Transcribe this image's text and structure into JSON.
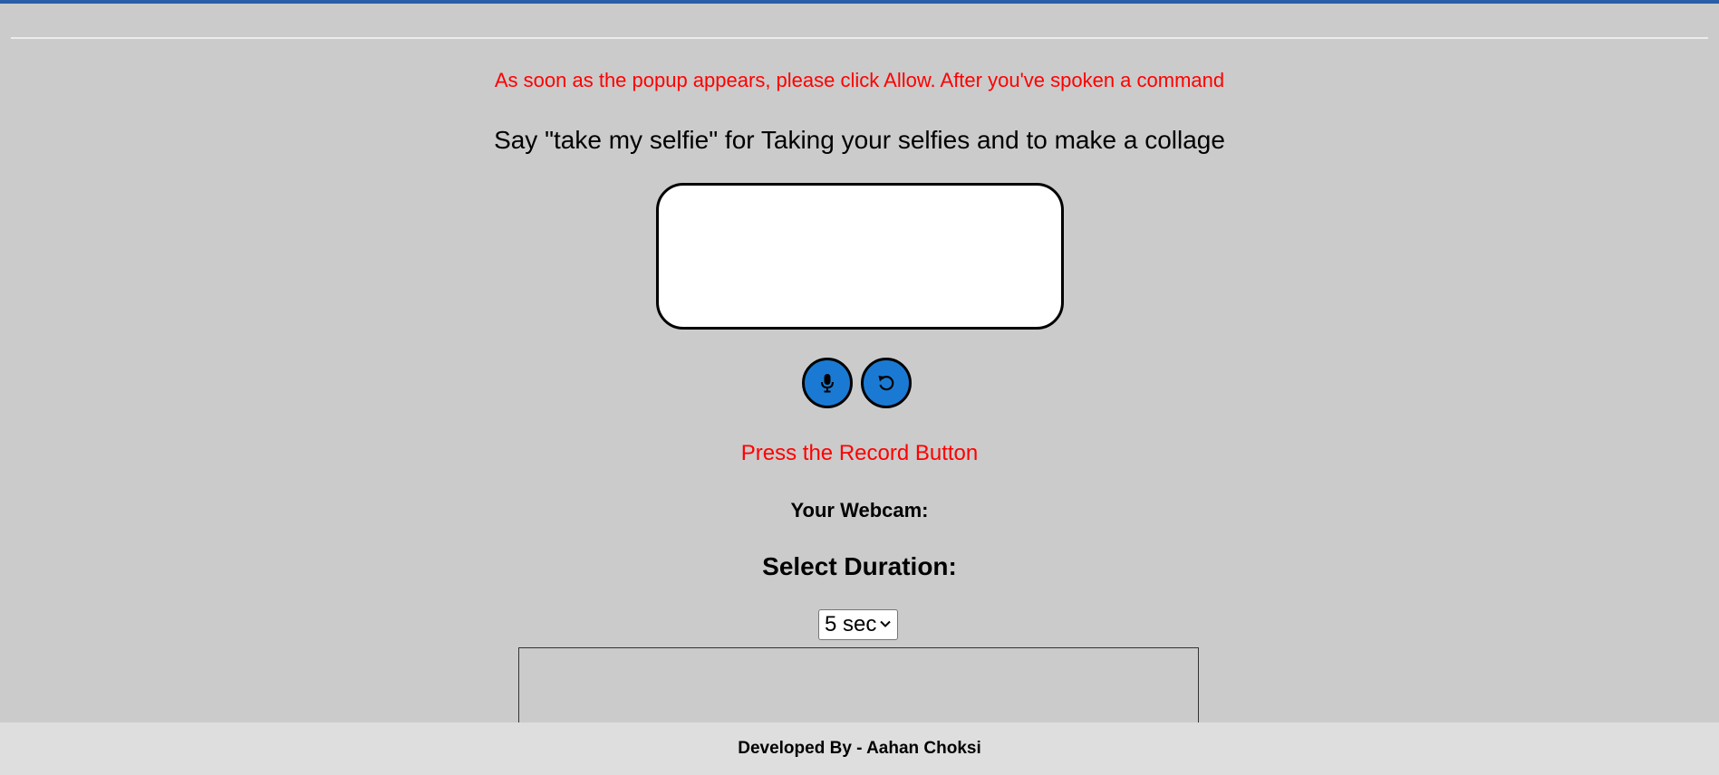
{
  "header": {
    "title": ""
  },
  "main": {
    "instruction": "As soon as the popup appears, please click Allow. After you've spoken a command",
    "prompt": "Say \"take my selfie\" for Taking your selfies and to make a collage",
    "transcript_value": "",
    "controls": {
      "record_icon": "microphone-icon",
      "reset_icon": "reset-icon",
      "button_color": "#1a7ad3"
    },
    "status": "Press the Record Button",
    "webcam_label": "Your Webcam:",
    "duration_label": "Select Duration:",
    "duration_selected": "5 sec"
  },
  "colors": {
    "background": "#cbcbcb",
    "alert_text": "#ff0000",
    "top_accent": "#2a5ea8",
    "footer_bg": "#dedede"
  },
  "footer": {
    "credit": "Developed By - Aahan Choksi"
  }
}
